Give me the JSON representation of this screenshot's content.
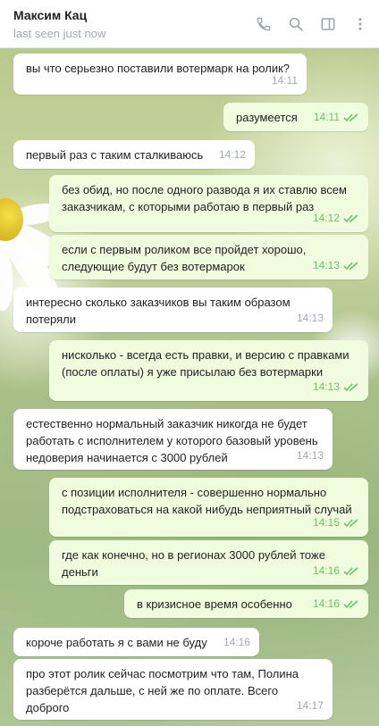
{
  "contact": {
    "name": "Максим Кац",
    "status": "last seen just now"
  },
  "header_icons": [
    "phone-icon",
    "search-icon",
    "sidebar-toggle-icon",
    "more-vertical-icon"
  ],
  "colors": {
    "incoming_bubble": "#ffffff",
    "outgoing_bubble": "#effdde",
    "read_check": "#6cc264"
  },
  "messages": [
    {
      "text": "вы что серьезно поставили вотермарк на ролик?",
      "time": "14:11"
    },
    {
      "text": "разумеется",
      "time": "14:11"
    },
    {
      "text": "первый раз с таким сталкиваюсь",
      "time": "14:12"
    },
    {
      "text": "без обид, но после одного развода я их ставлю всем заказчикам, с которыми работаю в первый раз",
      "time": "14:12"
    },
    {
      "text": "если с первым роликом все пройдет хорошо, следующие будут без вотермарок",
      "time": "14:13"
    },
    {
      "text": "интересно сколько заказчиков вы таким образом потеряли",
      "time": "14:13"
    },
    {
      "text": "нисколько - всегда есть правки, и версию с правками (после оплаты) я уже присылаю без вотермарки",
      "time": "14:13"
    },
    {
      "text": "естественно нормальный заказчик никогда не будет работать с исполнителем у которого базовый уровень недоверия начинается с 3000 рублей",
      "time": "14:13"
    },
    {
      "text": "с позиции исполнителя - совершенно нормально подстраховаться на какой нибудь неприятный случай",
      "time": "14:15"
    },
    {
      "text": "где как конечно, но в регионах 3000 рублей тоже деньги",
      "time": "14:16"
    },
    {
      "text": "в кризисное время особенно",
      "time": "14:16"
    },
    {
      "text": "короче работать я с вами не буду",
      "time": "14:16"
    },
    {
      "text": "про этот ролик сейчас посмотрим что там, Полина разберётся дальше, с ней же по оплате. Всего доброго",
      "time": "14:17"
    }
  ]
}
